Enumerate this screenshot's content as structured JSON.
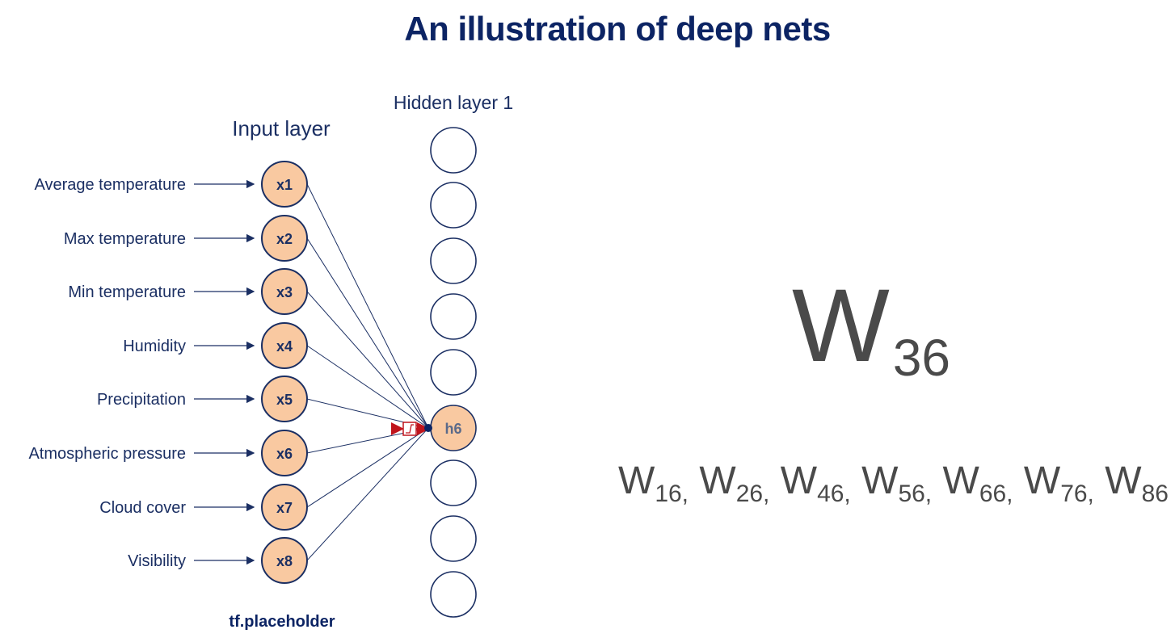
{
  "title": "An illustration of deep nets",
  "input_layer_label": "Input layer",
  "hidden_layer_label": "Hidden layer 1",
  "inputs": [
    {
      "feature": "Average temperature",
      "node": "x1"
    },
    {
      "feature": "Max temperature",
      "node": "x2"
    },
    {
      "feature": "Min temperature",
      "node": "x3"
    },
    {
      "feature": "Humidity",
      "node": "x4"
    },
    {
      "feature": "Precipitation",
      "node": "x5"
    },
    {
      "feature": "Atmospheric pressure",
      "node": "x6"
    },
    {
      "feature": "Cloud cover",
      "node": "x7"
    },
    {
      "feature": "Visibility",
      "node": "x8"
    }
  ],
  "hidden_nodes": [
    "",
    "",
    "",
    "",
    "",
    "h6",
    "",
    "",
    ""
  ],
  "active_hidden_node": "h6",
  "placeholder_label": "tf.placeholder",
  "highlight_weight": {
    "symbol": "W",
    "subscript": "36"
  },
  "other_weights": [
    {
      "symbol": "W",
      "subscript": "16,"
    },
    {
      "symbol": "W",
      "subscript": "26,"
    },
    {
      "symbol": "W",
      "subscript": "46,"
    },
    {
      "symbol": "W",
      "subscript": "56,"
    },
    {
      "symbol": "W",
      "subscript": "66,"
    },
    {
      "symbol": "W",
      "subscript": "76,"
    },
    {
      "symbol": "W",
      "subscript": "86"
    }
  ],
  "colors": {
    "navy": "#1b2f63",
    "node_fill": "#f9c9a1",
    "activation": "#c0141c",
    "weight_text": "#4a4a4a"
  }
}
